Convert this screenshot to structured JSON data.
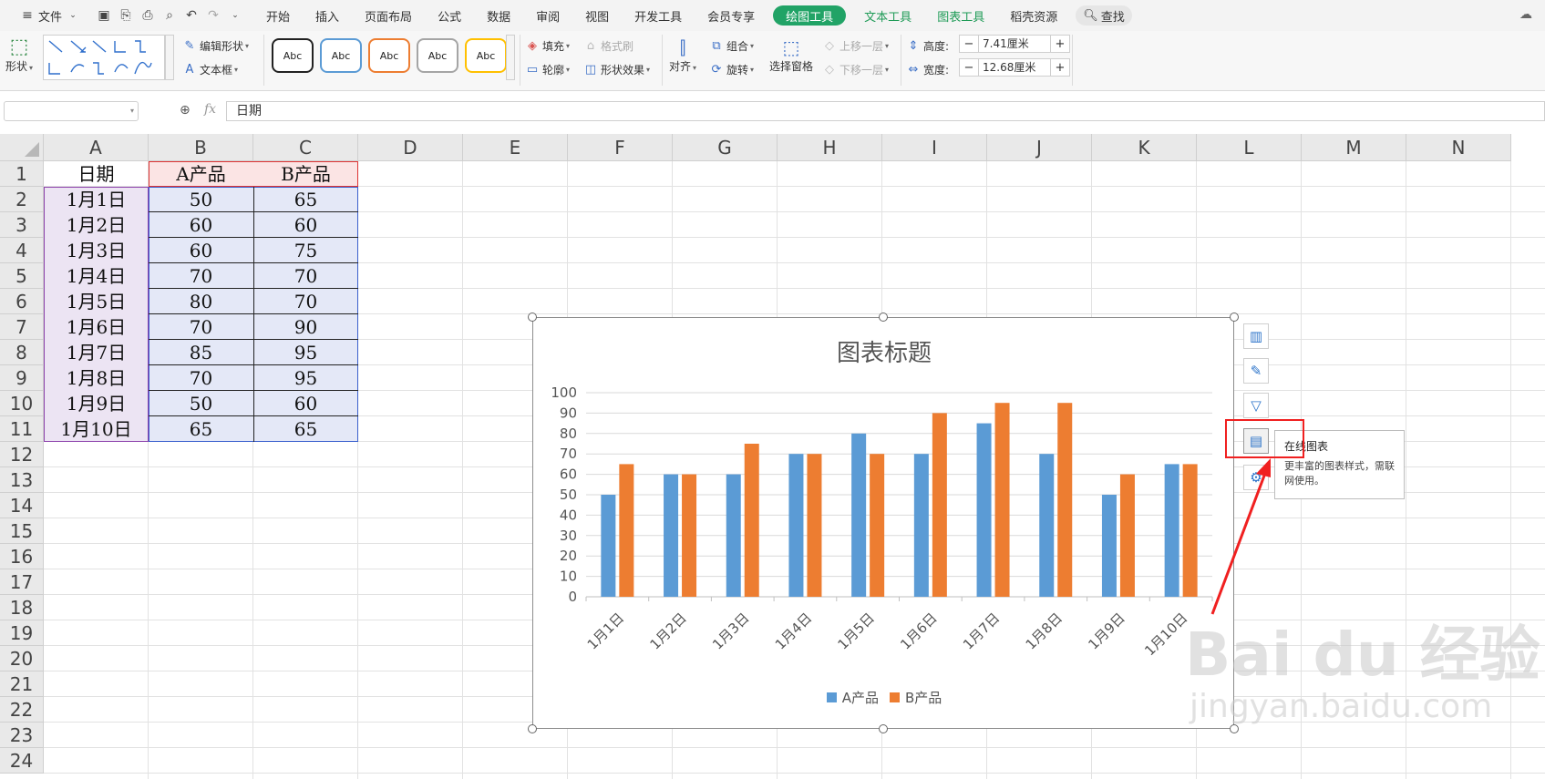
{
  "menu": {
    "file": "文件",
    "tabs": [
      "开始",
      "插入",
      "页面布局",
      "公式",
      "数据",
      "审阅",
      "视图",
      "开发工具",
      "会员专享"
    ],
    "context_tabs": [
      {
        "label": "绘图工具",
        "style": "pill"
      },
      {
        "label": "文本工具",
        "style": "green"
      },
      {
        "label": "图表工具",
        "style": "green"
      },
      {
        "label": "稻壳资源",
        "style": "plain"
      }
    ],
    "search": "查找"
  },
  "ribbon": {
    "shape": "形状",
    "edit_shape": "编辑形状",
    "text_box": "文本框",
    "style_samples": [
      "Abc",
      "Abc",
      "Abc",
      "Abc",
      "Abc"
    ],
    "style_colors": [
      "#222222",
      "#5b9bd5",
      "#ed7d31",
      "#a5a5a5",
      "#ffc000"
    ],
    "fill": "填充",
    "format_painter": "格式刷",
    "outline": "轮廓",
    "shape_effects": "形状效果",
    "align": "对齐",
    "group": "组合",
    "rotate": "旋转",
    "selection_pane": "选择窗格",
    "bring_forward": "上移一层",
    "send_backward": "下移一层",
    "height_label": "高度:",
    "height_value": "7.41厘米",
    "width_label": "宽度:",
    "width_value": "12.68厘米"
  },
  "formula_bar": {
    "name_box": "",
    "fx": "fx",
    "content": "日期"
  },
  "sheet": {
    "columns": [
      "A",
      "B",
      "C",
      "D",
      "E",
      "F",
      "G",
      "H",
      "I",
      "J",
      "K",
      "L",
      "M",
      "N"
    ],
    "rows": [
      "1",
      "2",
      "3",
      "4",
      "5",
      "6",
      "7",
      "8",
      "9",
      "10",
      "11",
      "12",
      "13",
      "14",
      "15",
      "16",
      "17",
      "18",
      "19",
      "20",
      "21",
      "22",
      "23",
      "24"
    ],
    "header": [
      "日期",
      "A产品",
      "B产品"
    ],
    "data": [
      [
        "1月1日",
        "50",
        "65"
      ],
      [
        "1月2日",
        "60",
        "60"
      ],
      [
        "1月3日",
        "60",
        "75"
      ],
      [
        "1月4日",
        "70",
        "70"
      ],
      [
        "1月5日",
        "80",
        "70"
      ],
      [
        "1月6日",
        "70",
        "90"
      ],
      [
        "1月7日",
        "85",
        "95"
      ],
      [
        "1月8日",
        "70",
        "95"
      ],
      [
        "1月9日",
        "50",
        "60"
      ],
      [
        "1月10日",
        "65",
        "65"
      ]
    ]
  },
  "chart_data": {
    "type": "bar",
    "title": "图表标题",
    "categories": [
      "1月1日",
      "1月2日",
      "1月3日",
      "1月4日",
      "1月5日",
      "1月6日",
      "1月7日",
      "1月8日",
      "1月9日",
      "1月10日"
    ],
    "series": [
      {
        "name": "A产品",
        "values": [
          50,
          60,
          60,
          70,
          80,
          70,
          85,
          70,
          50,
          65
        ],
        "color": "#5b9bd5"
      },
      {
        "name": "B产品",
        "values": [
          65,
          60,
          75,
          70,
          70,
          90,
          95,
          95,
          60,
          65
        ],
        "color": "#ed7d31"
      }
    ],
    "yticks": [
      "0",
      "10",
      "20",
      "30",
      "40",
      "50",
      "60",
      "70",
      "80",
      "90",
      "100"
    ],
    "ylim": [
      0,
      100
    ],
    "grid": true,
    "legend": "bottom"
  },
  "chart_tools": {
    "tooltip_title": "在线图表",
    "tooltip_body": "更丰富的图表样式，需联网使用。"
  },
  "watermark": {
    "main": "Bai du 经验",
    "sub": "jingyan.baidu.com"
  }
}
